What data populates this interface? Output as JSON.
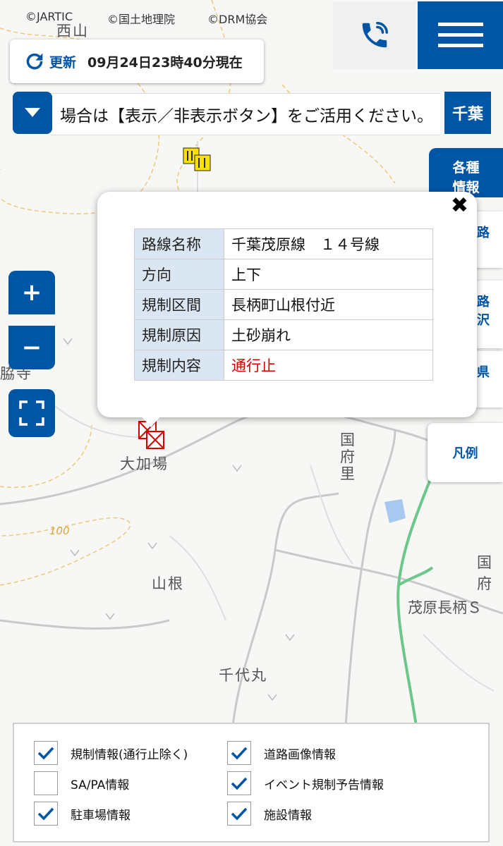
{
  "credits": [
    "©JARTIC",
    "©国土地理院",
    "©DRM協会"
  ],
  "header": {
    "update_label": "更新",
    "update_time": "09月24日23時40分現在"
  },
  "ticker": {
    "text": "場合は【表示／非表示ボタン】をご活用ください。"
  },
  "prefecture_button": "千葉",
  "side_panel": {
    "tab_line1": "各種",
    "tab_line2": "情報",
    "items": [
      {
        "line1": "路",
        "line2": ""
      },
      {
        "line1": "路",
        "line2": "沢"
      },
      {
        "line1": "県",
        "line2": ""
      }
    ],
    "legend": "凡例"
  },
  "zoom": {
    "in": "+",
    "out": "−"
  },
  "map_labels": {
    "nishiyama": "西山",
    "oaba": "大加場",
    "yamane": "山根",
    "chiyomaru": "千代丸",
    "kokufuri": "国府里",
    "mobara_ic": "茂原長柄Ｓ",
    "kokufu_r": "国府",
    "contour": "100",
    "wakiji": "脇寺"
  },
  "popup": {
    "rows": [
      {
        "key": "路線名称",
        "value": "千葉茂原線　１４号線"
      },
      {
        "key": "方向",
        "value": "上下"
      },
      {
        "key": "規制区間",
        "value": "長柄町山根付近"
      },
      {
        "key": "規制原因",
        "value": "土砂崩れ"
      },
      {
        "key": "規制内容",
        "value": "通行止"
      }
    ],
    "alert_color": "#d40000"
  },
  "filters": [
    {
      "label": "規制情報(通行止除く)",
      "checked": true
    },
    {
      "label": "道路画像情報",
      "checked": true
    },
    {
      "label": "SA/PA情報",
      "checked": false
    },
    {
      "label": "イベント規制予告情報",
      "checked": true
    },
    {
      "label": "駐車場情報",
      "checked": true
    },
    {
      "label": "施設情報",
      "checked": true
    }
  ],
  "colors": {
    "accent": "#0055a5",
    "expressway": "#6cc88a",
    "contour": "#f0c878"
  }
}
